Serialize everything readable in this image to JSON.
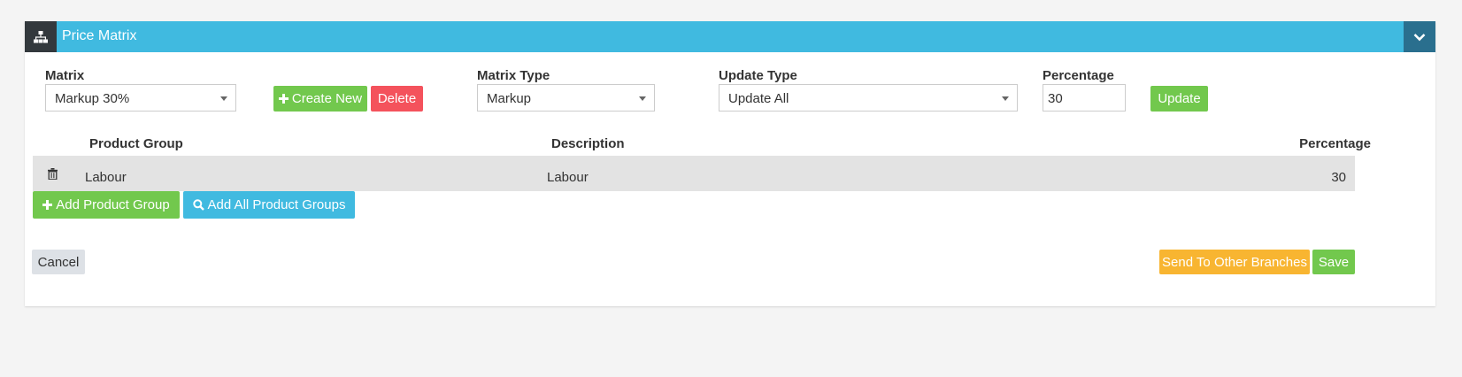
{
  "panel": {
    "title": "Price Matrix"
  },
  "icons": {
    "header": "sitemap-icon",
    "collapse": "chevron-down-icon",
    "delete_row": "trash-icon",
    "create": "plus-icon",
    "search": "search-icon"
  },
  "colors": {
    "header": "#40bae0",
    "header_icon_bg": "#33393d",
    "collapse_bg": "#2a6f8e",
    "green": "#72c84d",
    "red": "#f4525c",
    "orange": "#f8b531",
    "grey": "#dde1e6"
  },
  "form": {
    "matrix": {
      "label": "Matrix",
      "value": "Markup 30%"
    },
    "create_new": "Create New",
    "delete": "Delete",
    "matrix_type": {
      "label": "Matrix Type",
      "value": "Markup"
    },
    "update_type": {
      "label": "Update Type",
      "value": "Update All"
    },
    "percentage": {
      "label": "Percentage",
      "value": "30"
    },
    "update": "Update"
  },
  "table": {
    "columns": [
      "Product Group",
      "Description",
      "Percentage"
    ],
    "rows": [
      {
        "product_group": "Labour",
        "description": "Labour",
        "percentage": "30"
      }
    ]
  },
  "actions": {
    "add_product_group": "Add Product Group",
    "add_all_product_groups": "Add All Product Groups",
    "cancel": "Cancel",
    "send_to_other_branches": "Send To Other Branches",
    "save": "Save"
  }
}
